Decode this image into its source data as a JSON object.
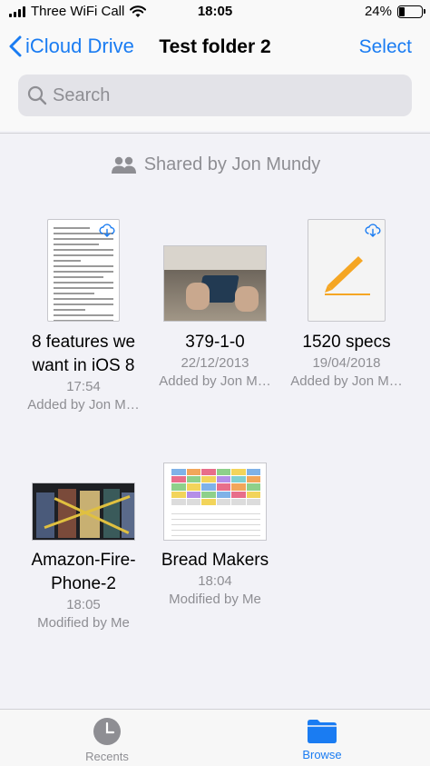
{
  "status_bar": {
    "carrier": "Three WiFi Call",
    "time": "18:05",
    "battery_percent": "24%",
    "battery_level": 0.24
  },
  "nav": {
    "back_label": "iCloud Drive",
    "title": "Test folder 2",
    "select_label": "Select"
  },
  "search": {
    "placeholder": "Search"
  },
  "shared_by": "Shared by Jon Mundy",
  "files": [
    {
      "name_line1": "8 features we",
      "name_line2": "want in iOS 8",
      "date": "17:54",
      "info": "Added by Jon M…"
    },
    {
      "name_line1": "379-1-0",
      "date": "22/12/2013",
      "info": "Added by Jon M…"
    },
    {
      "name_line1": "1520 specs",
      "date": "19/04/2018",
      "info": "Added by Jon M…"
    },
    {
      "name_line1": "Amazon-Fire-",
      "name_line2": "Phone-2",
      "date": "18:05",
      "info": "Modified by Me"
    },
    {
      "name_line1": "Bread Makers",
      "date": "18:04",
      "info": "Modified by Me"
    }
  ],
  "tab_bar": {
    "recents": "Recents",
    "browse": "Browse"
  },
  "colors": {
    "accent": "#1a7cf2",
    "secondary_text": "#8e8e93",
    "pencil": "#f5a623"
  }
}
